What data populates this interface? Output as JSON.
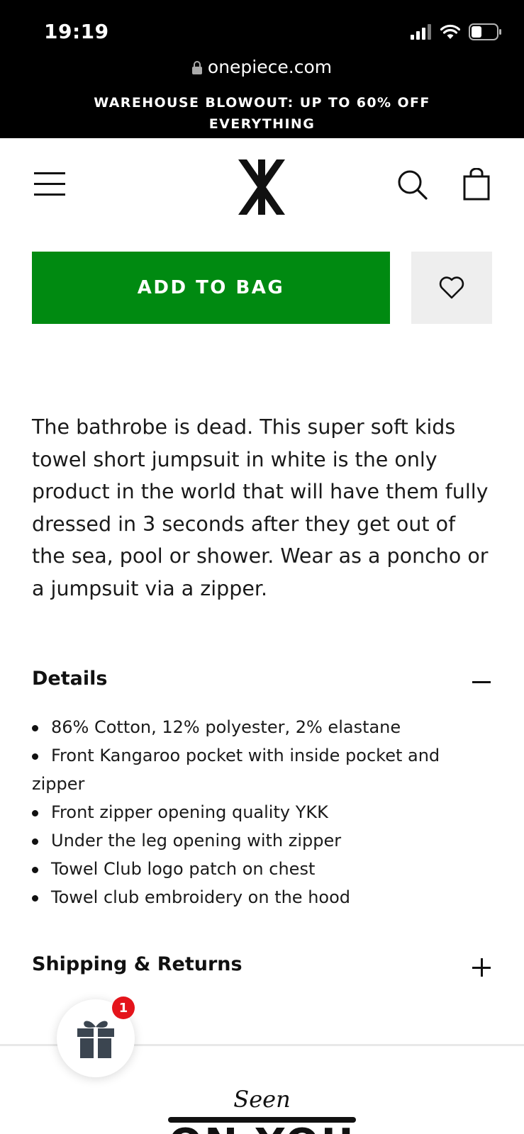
{
  "status_bar": {
    "time": "19:19",
    "icons": [
      "signal-icon",
      "wifi-icon",
      "battery-icon"
    ]
  },
  "browser": {
    "url": "onepiece.com"
  },
  "promo_banner": {
    "line1": "WAREHOUSE BLOWOUT: UP TO 60% OFF",
    "line2": "EVERYTHING"
  },
  "header": {
    "icons": [
      "menu-icon",
      "brand-logo",
      "search-icon",
      "bag-icon"
    ]
  },
  "product": {
    "add_to_bag_label": "ADD TO BAG",
    "description": "The bathrobe is dead. This super soft kids towel short jumpsuit in white is the only product in the world that will have them fully dressed in 3 seconds after they get out of the sea, pool or shower. Wear as a poncho or a jumpsuit via a zipper."
  },
  "details": {
    "title": "Details",
    "expanded": true,
    "items": [
      "86% Cotton, 12% polyester, 2% elastane",
      "Front Kangaroo pocket with inside pocket and",
      "Front zipper opening quality YKK",
      "Under the leg opening with zipper",
      "Towel Club logo patch on chest",
      "Towel club embroidery on the hood"
    ],
    "item2_continuation": "zipper"
  },
  "shipping": {
    "title": "Shipping & Returns",
    "expanded": false
  },
  "gift_widget": {
    "badge_count": "1"
  },
  "seen_on_you": {
    "seen": "Seen",
    "on_you": "ON YOU"
  },
  "colors": {
    "add_to_bag_bg": "#008a11",
    "topbar_bg": "#000000",
    "badge_red": "#e4141b",
    "wishlist_bg": "#eeeeee"
  }
}
